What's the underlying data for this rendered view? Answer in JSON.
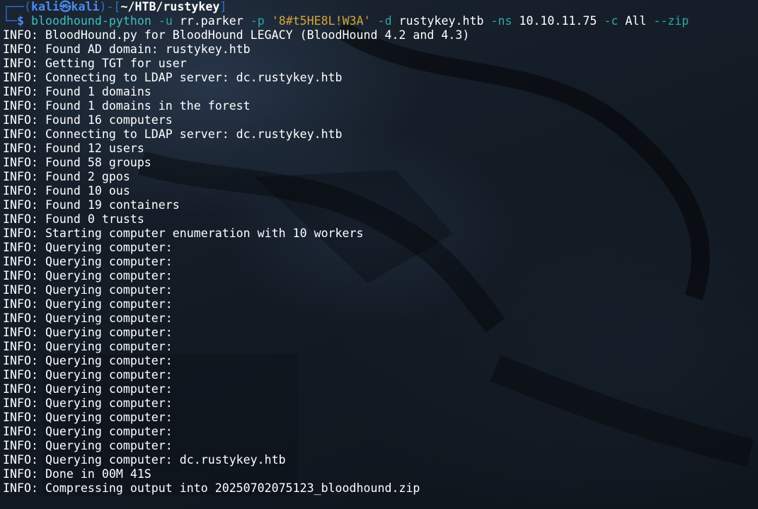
{
  "prompt": {
    "box_top": "┌──(",
    "user": "kali",
    "skull": "㉿",
    "host": "kali",
    "box_mid": ")-[",
    "path": "~/HTB/rustykey",
    "box_end": "]",
    "box_bottom": "└─",
    "symbol": "$"
  },
  "command": {
    "program": "bloodhound-python",
    "parts": [
      {
        "type": "flag",
        "text": "-u"
      },
      {
        "type": "arg",
        "text": "rr.parker"
      },
      {
        "type": "flag",
        "text": "-p"
      },
      {
        "type": "str",
        "text": "'8#t5HE8L!W3A'"
      },
      {
        "type": "flag",
        "text": "-d"
      },
      {
        "type": "arg",
        "text": "rustykey.htb"
      },
      {
        "type": "flag",
        "text": "-ns"
      },
      {
        "type": "arg",
        "text": "10.10.11.75"
      },
      {
        "type": "flag",
        "text": "-c"
      },
      {
        "type": "arg",
        "text": "All"
      },
      {
        "type": "flag",
        "text": "--zip"
      }
    ]
  },
  "output": [
    "INFO: BloodHound.py for BloodHound LEGACY (BloodHound 4.2 and 4.3)",
    "INFO: Found AD domain: rustykey.htb",
    "INFO: Getting TGT for user",
    "INFO: Connecting to LDAP server: dc.rustykey.htb",
    "INFO: Found 1 domains",
    "INFO: Found 1 domains in the forest",
    "INFO: Found 16 computers",
    "INFO: Connecting to LDAP server: dc.rustykey.htb",
    "INFO: Found 12 users",
    "INFO: Found 58 groups",
    "INFO: Found 2 gpos",
    "INFO: Found 10 ous",
    "INFO: Found 19 containers",
    "INFO: Found 0 trusts",
    "INFO: Starting computer enumeration with 10 workers",
    "INFO: Querying computer:",
    "INFO: Querying computer:",
    "INFO: Querying computer:",
    "INFO: Querying computer:",
    "INFO: Querying computer:",
    "INFO: Querying computer:",
    "INFO: Querying computer:",
    "INFO: Querying computer:",
    "INFO: Querying computer:",
    "INFO: Querying computer:",
    "INFO: Querying computer:",
    "INFO: Querying computer:",
    "INFO: Querying computer:",
    "INFO: Querying computer:",
    "INFO: Querying computer:",
    "INFO: Querying computer: dc.rustykey.htb",
    "INFO: Done in 00M 41S",
    "INFO: Compressing output into 20250702075123_bloodhound.zip"
  ],
  "colors": {
    "background": "#111820",
    "prompt_blue": "#4b8af0",
    "command_cyan": "#3fbfbf",
    "string_yellow": "#d4a63c",
    "text_white": "#ffffff"
  }
}
